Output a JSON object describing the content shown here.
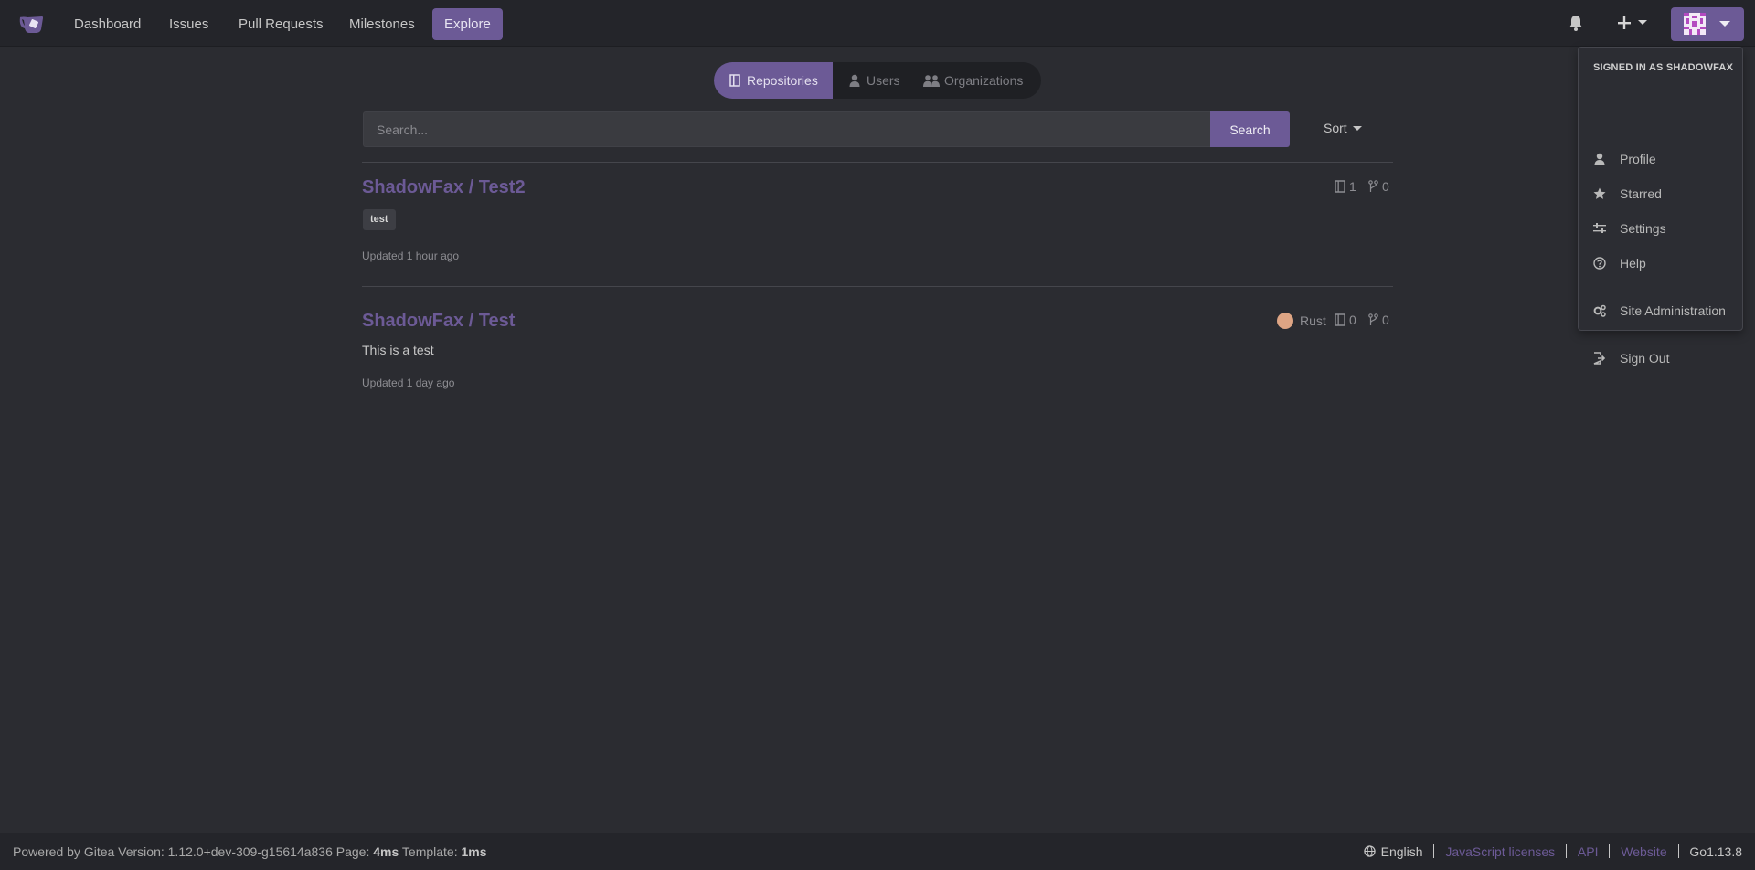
{
  "nav": {
    "items": [
      {
        "label": "Dashboard"
      },
      {
        "label": "Issues"
      },
      {
        "label": "Pull Requests"
      },
      {
        "label": "Milestones"
      },
      {
        "label": "Explore"
      }
    ],
    "active_index": 4
  },
  "user_menu": {
    "header": "SIGNED IN AS SHADOWFAX",
    "items": [
      {
        "label": "Profile",
        "icon": "person-icon"
      },
      {
        "label": "Starred",
        "icon": "star-icon"
      },
      {
        "label": "Settings",
        "icon": "settings-icon"
      },
      {
        "label": "Help",
        "icon": "help-icon"
      },
      {
        "label": "Site Administration",
        "icon": "server-gears-icon"
      },
      {
        "label": "Sign Out",
        "icon": "sign-out-icon"
      }
    ]
  },
  "explore_tabs": [
    {
      "label": "Repositories",
      "icon": "repo-icon"
    },
    {
      "label": "Users",
      "icon": "person-icon"
    },
    {
      "label": "Organizations",
      "icon": "organization-icon"
    }
  ],
  "search": {
    "placeholder": "Search...",
    "value": "",
    "button_label": "Search",
    "sort_label": "Sort"
  },
  "repos": [
    {
      "owner_name": "ShadowFax / Test2",
      "topic": "test",
      "description": "",
      "language": "",
      "stars": "1",
      "forks": "0",
      "updated": "Updated 1 hour ago"
    },
    {
      "owner_name": "ShadowFax / Test",
      "topic": "",
      "description": "This is a test",
      "language": "Rust",
      "language_color": "#dea584",
      "stars": "0",
      "forks": "0",
      "updated": "Updated 1 day ago"
    }
  ],
  "footer": {
    "powered_by": "Powered by Gitea Version: 1.12.0+dev-309-g15614a836 Page:",
    "page_time": "4ms",
    "template_label": "Template:",
    "template_time": "1ms",
    "language": "English",
    "links": [
      "JavaScript licenses",
      "API",
      "Website"
    ],
    "go_version": "Go1.13.8"
  },
  "colors": {
    "accent": "#6c5a96",
    "background": "#2b2c31",
    "navbar": "#24252a"
  }
}
